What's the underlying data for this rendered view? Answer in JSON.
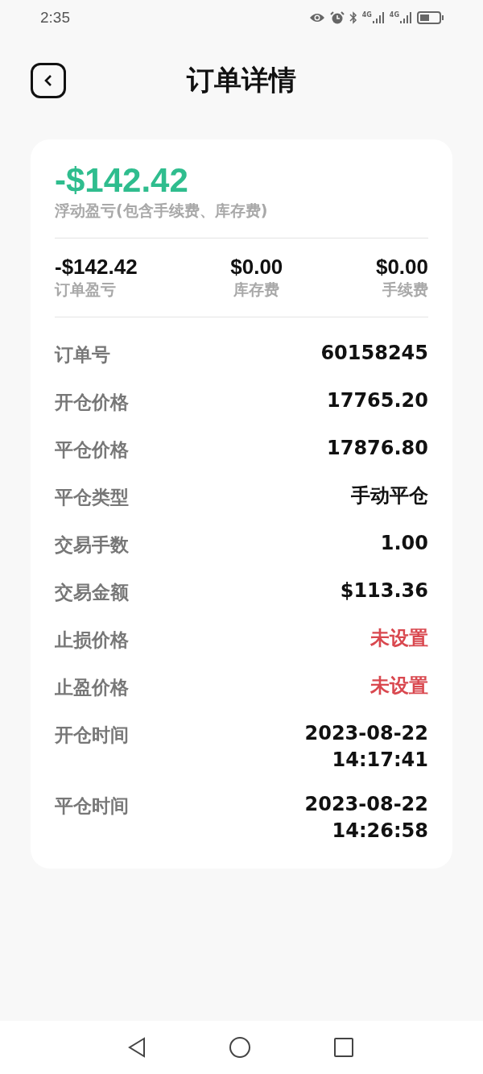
{
  "status_bar": {
    "time": "2:35",
    "signals": [
      "4G",
      "4G"
    ]
  },
  "header": {
    "title": "订单详情"
  },
  "summary": {
    "amount": "-$142.42",
    "caption": "浮动盈亏(包含手续费、库存费)"
  },
  "stats": [
    {
      "value": "-$142.42",
      "label": "订单盈亏"
    },
    {
      "value": "$0.00",
      "label": "库存费"
    },
    {
      "value": "$0.00",
      "label": "手续费"
    }
  ],
  "details": [
    {
      "label": "订单号",
      "lines": [
        "60158245"
      ],
      "kind": "plain"
    },
    {
      "label": "开仓价格",
      "lines": [
        "17765.20"
      ],
      "kind": "plain"
    },
    {
      "label": "平仓价格",
      "lines": [
        "17876.80"
      ],
      "kind": "plain"
    },
    {
      "label": "平仓类型",
      "lines": [
        "手动平仓"
      ],
      "kind": "plain"
    },
    {
      "label": "交易手数",
      "lines": [
        "1.00"
      ],
      "kind": "plain"
    },
    {
      "label": "交易金额",
      "lines": [
        "$113.36"
      ],
      "kind": "plain"
    },
    {
      "label": "止损价格",
      "lines": [
        "未设置"
      ],
      "kind": "alert"
    },
    {
      "label": "止盈价格",
      "lines": [
        "未设置"
      ],
      "kind": "alert"
    },
    {
      "label": "开仓时间",
      "lines": [
        "2023-08-22",
        "14:17:41"
      ],
      "kind": "plain"
    },
    {
      "label": "平仓时间",
      "lines": [
        "2023-08-22",
        "14:26:58"
      ],
      "kind": "plain"
    }
  ]
}
